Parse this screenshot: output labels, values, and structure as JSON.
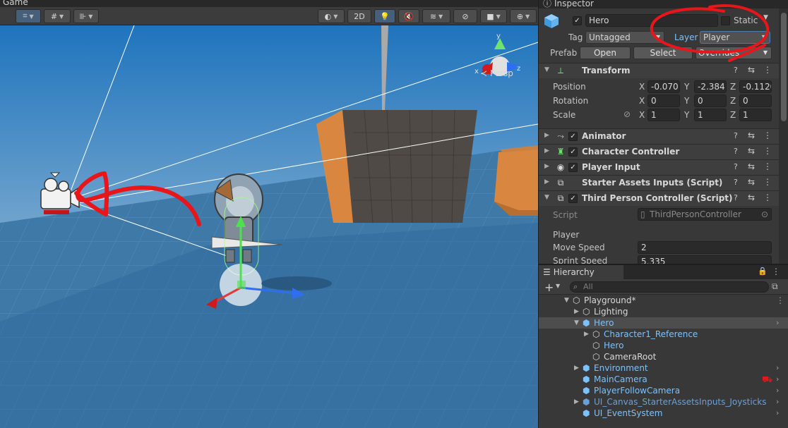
{
  "scene": {
    "tab_label": "Game",
    "toolbar": {
      "btn_2d": "2D"
    },
    "persp_label": "Persp",
    "gizmo_axes": {
      "y": "y",
      "x": "x",
      "z": "z"
    }
  },
  "inspector": {
    "tab_label": "Inspector",
    "object_name": "Hero",
    "static_label": "Static",
    "tag_label": "Tag",
    "tag_value": "Untagged",
    "layer_label": "Layer",
    "layer_value": "Player",
    "prefab_label": "Prefab",
    "prefab_open": "Open",
    "prefab_select": "Select",
    "prefab_overrides": "Overrides",
    "transform": {
      "title": "Transform",
      "position_label": "Position",
      "rotation_label": "Rotation",
      "scale_label": "Scale",
      "axis_x": "X",
      "axis_y": "Y",
      "axis_z": "Z",
      "position": {
        "x": "-0.070",
        "y": "-2.384",
        "z": "-0.1120"
      },
      "rotation": {
        "x": "0",
        "y": "0",
        "z": "0"
      },
      "scale": {
        "x": "1",
        "y": "1",
        "z": "1"
      }
    },
    "components": [
      {
        "name": "Animator",
        "icon": "animator-icon"
      },
      {
        "name": "Character Controller",
        "icon": "character-controller-icon"
      },
      {
        "name": "Player Input",
        "icon": "player-input-icon"
      },
      {
        "name": "Starter Assets Inputs (Script)",
        "icon": "script-icon"
      },
      {
        "name": "Third Person Controller (Script)",
        "icon": "script-icon"
      }
    ],
    "script_label": "Script",
    "script_value": "ThirdPersonController",
    "player_section": "Player",
    "move_speed_label": "Move Speed",
    "move_speed_value": "2",
    "sprint_speed_label": "Sprint Speed",
    "sprint_speed_value": "5.335"
  },
  "hierarchy": {
    "tab_label": "Hierarchy",
    "search_placeholder": "All",
    "items": [
      {
        "label": "Playground*"
      },
      {
        "label": "Lighting"
      },
      {
        "label": "Hero"
      },
      {
        "label": "Character1_Reference"
      },
      {
        "label": "Hero"
      },
      {
        "label": "CameraRoot"
      },
      {
        "label": "Environment"
      },
      {
        "label": "MainCamera"
      },
      {
        "label": "PlayerFollowCamera"
      },
      {
        "label": "UI_Canvas_StarterAssetsInputs_Joysticks"
      },
      {
        "label": "UI_EventSystem"
      }
    ]
  },
  "colors": {
    "selection": "#46607c",
    "prefab_blue": "#7ac2ff",
    "annotation_red": "#e8161b"
  }
}
